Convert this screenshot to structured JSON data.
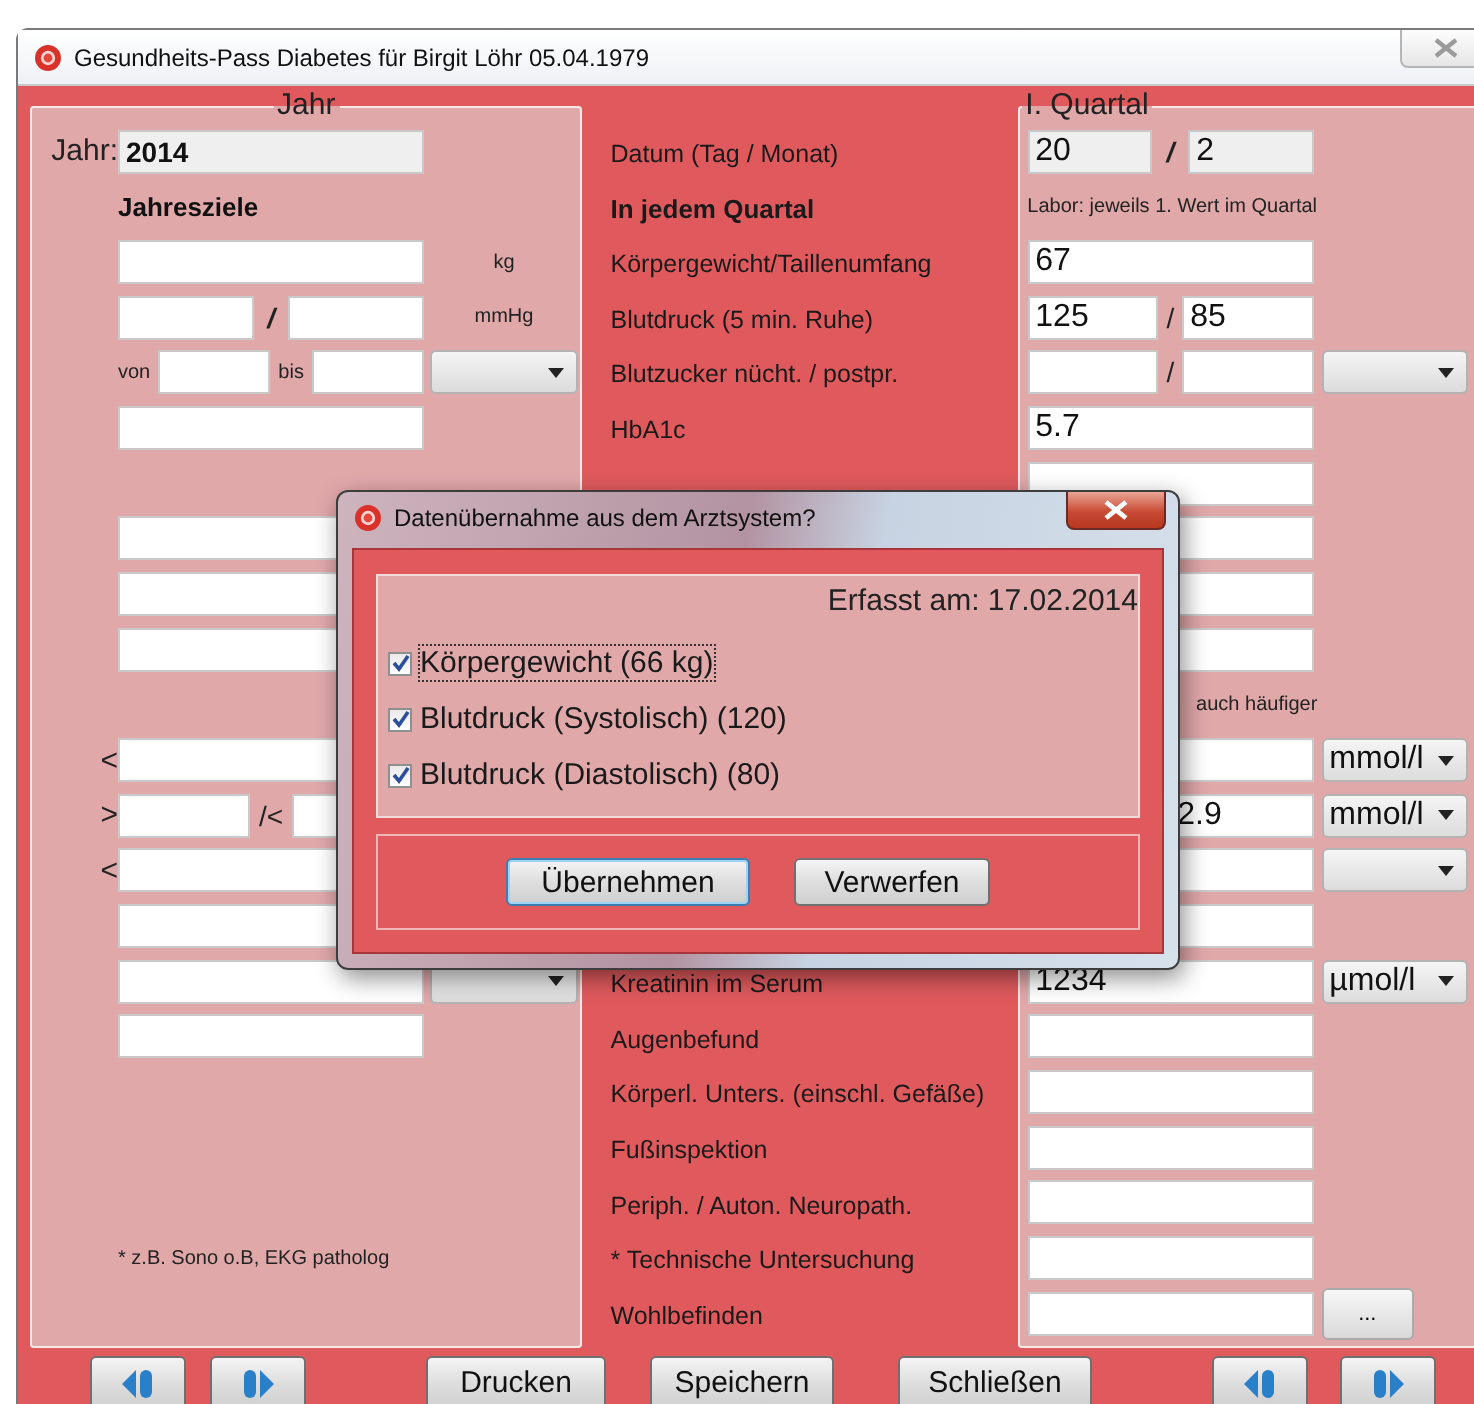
{
  "window": {
    "title": "Gesundheits-Pass Diabetes für Birgit Löhr 05.04.1979"
  },
  "year_panel": {
    "title": "Jahr",
    "groups": [
      {
        "rows": [
          {
            "prefix": "Jahr:",
            "main": [
              {
                "kind": "display",
                "value": "2014"
              }
            ]
          },
          {
            "main": [
              {
                "kind": "bold",
                "text": "Jahresziele"
              }
            ]
          },
          {
            "main": [
              {
                "kind": "field"
              }
            ],
            "suffix": {
              "kind": "unit",
              "text": "kg"
            }
          },
          {
            "main": [
              {
                "kind": "field"
              },
              {
                "kind": "slash",
                "text": "/"
              },
              {
                "kind": "field"
              }
            ],
            "suffix": {
              "kind": "unit",
              "text": "mmHg"
            }
          },
          {
            "main": [
              {
                "kind": "small",
                "text": "von"
              },
              {
                "kind": "field"
              },
              {
                "kind": "small",
                "text": "bis"
              },
              {
                "kind": "field"
              }
            ],
            "suffix": {
              "kind": "dropdown"
            }
          },
          {
            "main": [
              {
                "kind": "field"
              }
            ]
          }
        ]
      },
      {
        "rows": [
          {
            "main": [
              {
                "kind": "field"
              }
            ]
          },
          {
            "main": [
              {
                "kind": "field"
              }
            ]
          },
          {
            "main": [
              {
                "kind": "field"
              }
            ]
          }
        ]
      },
      {
        "rows": [
          {
            "prefix": "<",
            "main": [
              {
                "kind": "field"
              }
            ]
          },
          {
            "prefix": ">",
            "main": [
              {
                "kind": "field"
              },
              {
                "kind": "text",
                "text": "/<"
              },
              {
                "kind": "field"
              }
            ]
          },
          {
            "prefix": "<",
            "main": [
              {
                "kind": "field"
              }
            ]
          },
          {
            "main": [
              {
                "kind": "field"
              }
            ]
          },
          {
            "main": [
              {
                "kind": "field"
              }
            ],
            "suffix": {
              "kind": "dropdown"
            }
          },
          {
            "main": [
              {
                "kind": "field"
              }
            ]
          }
        ]
      },
      {
        "rows": [
          {
            "main": [
              {
                "kind": "note",
                "text": "* z.B. Sono o.B, EKG patholog"
              }
            ]
          }
        ]
      }
    ]
  },
  "label_groups": [
    {
      "labels": [
        {
          "kind": "label",
          "text": "Datum (Tag / Monat)"
        },
        {
          "kind": "heading",
          "text": "In jedem Quartal"
        },
        {
          "kind": "label",
          "text": "Körpergewicht/Taillenumfang"
        },
        {
          "kind": "label",
          "text": "Blutdruck (5 min. Ruhe)"
        },
        {
          "kind": "label",
          "text": "Blutzucker nücht. / postpr."
        },
        {
          "kind": "label",
          "text": "HbA1c"
        }
      ]
    },
    {
      "labels": [
        {
          "kind": "label",
          "text": "Kreatinin im Serum"
        },
        {
          "kind": "label",
          "text": "Augenbefund"
        },
        {
          "kind": "label",
          "text": "Körperl. Unters. (einschl. Gefäße)"
        },
        {
          "kind": "label",
          "text": "Fußinspektion"
        },
        {
          "kind": "label",
          "text": "Periph. / Auton. Neuropath."
        },
        {
          "kind": "label",
          "text": "* Technische Untersuchung"
        },
        {
          "kind": "label",
          "text": "Wohlbefinden"
        }
      ]
    }
  ],
  "quarter_panel": {
    "title": "I. Quartal",
    "rows": [
      {
        "main": [
          {
            "kind": "display",
            "value": "20"
          },
          {
            "kind": "slash",
            "text": "/"
          },
          {
            "kind": "display",
            "value": "2"
          }
        ]
      },
      {
        "main": [
          {
            "kind": "note",
            "text": "Labor: jeweils 1. Wert im Quartal"
          }
        ]
      },
      {
        "main": [
          {
            "kind": "field",
            "value": "67"
          }
        ]
      },
      {
        "main": [
          {
            "kind": "field",
            "value": "125"
          },
          {
            "kind": "text",
            "text": "/"
          },
          {
            "kind": "field",
            "value": "85"
          }
        ]
      },
      {
        "main": [
          {
            "kind": "field"
          },
          {
            "kind": "text",
            "text": "/"
          },
          {
            "kind": "field"
          }
        ],
        "suffix": {
          "kind": "dropdown"
        }
      },
      {
        "main": [
          {
            "kind": "field",
            "value": "5.7"
          }
        ]
      },
      {
        "main": [
          {
            "kind": "field"
          }
        ]
      },
      {
        "main": [
          {
            "kind": "field"
          }
        ]
      },
      {
        "main": [
          {
            "kind": "field"
          }
        ]
      },
      {
        "main": [
          {
            "kind": "field"
          }
        ]
      },
      {
        "main": [
          {
            "kind": "small",
            "text": "auch häufiger"
          }
        ]
      },
      {
        "main": [
          {
            "kind": "field"
          }
        ],
        "suffix": {
          "kind": "dropdown",
          "value": "mmol/l"
        }
      },
      {
        "main": [
          {
            "kind": "field",
            "value": "2.9"
          }
        ],
        "suffix": {
          "kind": "dropdown",
          "value": "mmol/l"
        }
      },
      {
        "main": [
          {
            "kind": "field"
          }
        ],
        "suffix": {
          "kind": "dropdown"
        }
      },
      {
        "main": [
          {
            "kind": "field"
          }
        ]
      },
      {
        "main": [
          {
            "kind": "field",
            "value": "1234"
          }
        ],
        "suffix": {
          "kind": "dropdown",
          "value": "µmol/l"
        }
      },
      {
        "main": [
          {
            "kind": "field"
          }
        ]
      },
      {
        "main": [
          {
            "kind": "field"
          }
        ]
      },
      {
        "main": [
          {
            "kind": "field"
          }
        ]
      },
      {
        "main": [
          {
            "kind": "field"
          }
        ]
      },
      {
        "main": [
          {
            "kind": "field"
          }
        ]
      },
      {
        "main": [
          {
            "kind": "field"
          }
        ],
        "suffix": {
          "kind": "button",
          "text": "..."
        }
      }
    ]
  },
  "bottom_bar": [
    {
      "kind": "previous"
    },
    {
      "kind": "next"
    },
    {
      "kind": "text",
      "label": "Drucken"
    },
    {
      "kind": "text",
      "label": "Speichern"
    },
    {
      "kind": "text",
      "label": "Schließen"
    },
    {
      "kind": "previous"
    },
    {
      "kind": "next"
    }
  ],
  "dialog": {
    "title": "Datenübernahme aus dem Arztsystem?",
    "captured": "Erfasst am: 17.02.2014",
    "items": [
      {
        "label": "Körpergewicht (66 kg)",
        "checked": true
      },
      {
        "label": "Blutdruck (Systolisch) (120)",
        "checked": true
      },
      {
        "label": "Blutdruck (Diastolisch) (80)",
        "checked": true
      }
    ],
    "buttons": [
      {
        "label": "Übernehmen",
        "focused": true
      },
      {
        "label": "Verwerfen",
        "focused": false
      }
    ]
  }
}
